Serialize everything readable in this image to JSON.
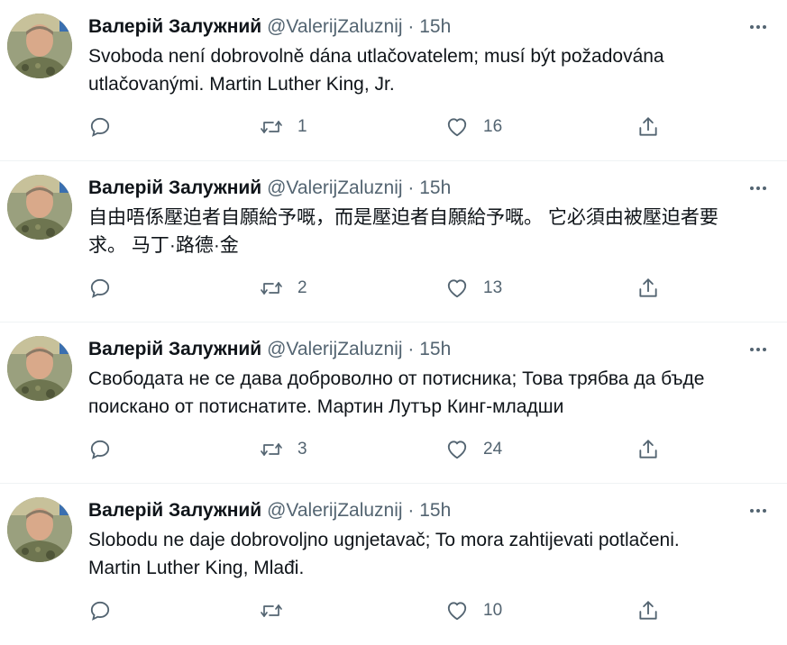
{
  "tweets": [
    {
      "author_name": "Валерій Залужний",
      "handle": "@ValerijZaluznij",
      "separator": "·",
      "time": "15h",
      "text": "Svoboda není dobrovolně dána utlačovatelem; musí být požadována\nutlačovanými. Martin Luther King, Jr.",
      "retweets": "1",
      "likes": "16"
    },
    {
      "author_name": "Валерій Залужний",
      "handle": "@ValerijZaluznij",
      "separator": "·",
      "time": "15h",
      "text": "自由唔係壓迫者自願給予嘅，而是壓迫者自願給予嘅。 它必須由被壓迫者要\n求。 马丁·路德·金",
      "retweets": "2",
      "likes": "13"
    },
    {
      "author_name": "Валерій Залужний",
      "handle": "@ValerijZaluznij",
      "separator": "·",
      "time": "15h",
      "text": "Свободата не се дава доброволно от потисника; Това трябва да бъде\nпоискано от потиснатите. Мартин Лутър Кинг-младши",
      "retweets": "3",
      "likes": "24"
    },
    {
      "author_name": "Валерій Залужний",
      "handle": "@ValerijZaluznij",
      "separator": "·",
      "time": "15h",
      "text": "Slobodu ne daje dobrovoljno ugnjetavač; To mora zahtijevati potlačeni.\nMartin Luther King, Mlađi.",
      "retweets": "",
      "likes": "10"
    }
  ],
  "icons": {
    "more": "more-horizontal-icon",
    "reply": "reply-icon",
    "retweet": "retweet-icon",
    "like": "heart-icon",
    "share": "share-icon"
  },
  "colors": {
    "text": "#0f1419",
    "secondary": "#536471",
    "divider": "#eff3f4"
  }
}
